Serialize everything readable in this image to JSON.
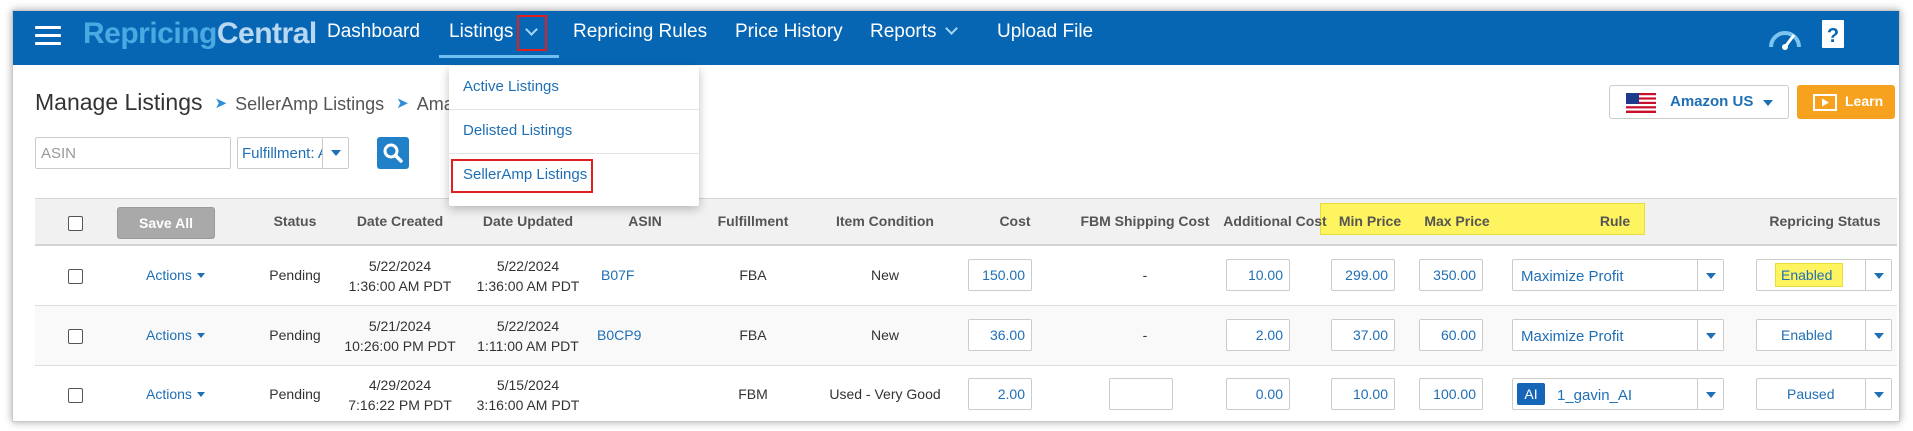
{
  "nav": {
    "logo_part1": "Repricing",
    "logo_part2": "Central",
    "items": [
      "Dashboard",
      "Listings",
      "Repricing Rules",
      "Price History",
      "Reports",
      "Upload File"
    ]
  },
  "listings_menu": [
    "Active Listings",
    "Delisted Listings",
    "SellerAmp Listings"
  ],
  "breadcrumb": {
    "title": "Manage Listings",
    "crumb1": "SellerAmp Listings",
    "crumb2": "Ama"
  },
  "filters": {
    "asin_placeholder": "ASIN",
    "fulfillment": "Fulfillment: All"
  },
  "marketplace": {
    "label": "Amazon US"
  },
  "learn_label": "Learn",
  "table": {
    "save_all": "Save All",
    "headers": {
      "status": "Status",
      "date_created": "Date Created",
      "date_updated": "Date Updated",
      "asin": "ASIN",
      "fulfillment": "Fulfillment",
      "condition": "Item Condition",
      "cost": "Cost",
      "fbm_shipping": "FBM Shipping Cost",
      "additional_cost": "Additional Cost",
      "min_price": "Min Price",
      "max_price": "Max Price",
      "rule": "Rule",
      "repricing_status": "Repricing Status"
    },
    "rows": [
      {
        "actions": "Actions",
        "status": "Pending",
        "created_date": "5/22/2024",
        "created_time": "1:36:00 AM PDT",
        "updated_date": "5/22/2024",
        "updated_time": "1:36:00 AM PDT",
        "asin": "B07F",
        "fulfillment": "FBA",
        "condition": "New",
        "cost": "150.00",
        "fbm_shipping": "-",
        "additional_cost": "10.00",
        "min_price": "299.00",
        "max_price": "350.00",
        "rule": "Maximize Profit",
        "rule_badge": "",
        "repricing_status": "Enabled"
      },
      {
        "actions": "Actions",
        "status": "Pending",
        "created_date": "5/21/2024",
        "created_time": "10:26:00 PM PDT",
        "updated_date": "5/22/2024",
        "updated_time": "1:11:00 AM PDT",
        "asin": "B0CP9",
        "fulfillment": "FBA",
        "condition": "New",
        "cost": "36.00",
        "fbm_shipping": "-",
        "additional_cost": "2.00",
        "min_price": "37.00",
        "max_price": "60.00",
        "rule": "Maximize Profit",
        "rule_badge": "",
        "repricing_status": "Enabled"
      },
      {
        "actions": "Actions",
        "status": "Pending",
        "created_date": "4/29/2024",
        "created_time": "7:16:22 PM PDT",
        "updated_date": "5/15/2024",
        "updated_time": "3:16:00 AM PDT",
        "asin": "",
        "fulfillment": "FBM",
        "condition": "Used - Very Good",
        "cost": "2.00",
        "fbm_shipping": "",
        "additional_cost": "0.00",
        "min_price": "10.00",
        "max_price": "100.00",
        "rule": "1_gavin_AI",
        "rule_badge": "AI",
        "repricing_status": "Paused"
      }
    ]
  },
  "colors": {
    "nav_bg": "#0766b4",
    "accent": "#1f6fb5",
    "highlight": "#fdf45f",
    "annotation": "#e02020",
    "learn": "#f7a21e"
  }
}
